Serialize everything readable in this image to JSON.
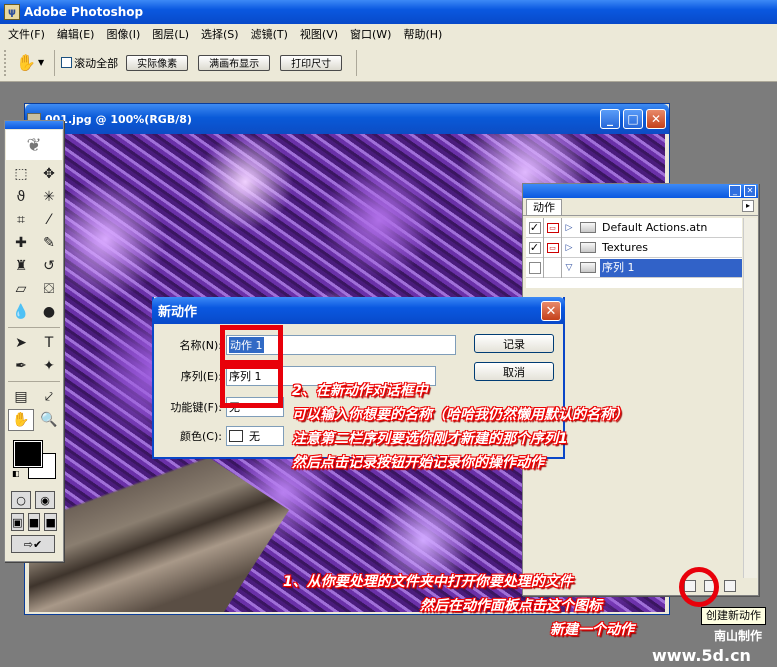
{
  "app": {
    "title": "Adobe Photoshop",
    "logo_icon": "photoshop-feather-icon"
  },
  "menu": [
    "文件(F)",
    "编辑(E)",
    "图像(I)",
    "图层(L)",
    "选择(S)",
    "滤镜(T)",
    "视图(V)",
    "窗口(W)",
    "帮助(H)"
  ],
  "options": {
    "tool_icon": "hand-icon",
    "scroll_all_label": "滚动全部",
    "buttons": [
      "实际像素",
      "满画布显示",
      "打印尺寸"
    ]
  },
  "document": {
    "title": "001.jpg @ 100%(RGB/8)"
  },
  "actions_panel": {
    "tab": "动作",
    "rows": [
      {
        "name": "Default Actions.atn",
        "checked": true,
        "dialog": true,
        "expanded": false,
        "selected": false
      },
      {
        "name": "Textures",
        "checked": true,
        "dialog": true,
        "expanded": false,
        "selected": false
      },
      {
        "name": "序列 1",
        "checked": false,
        "dialog": false,
        "expanded": true,
        "selected": true
      }
    ]
  },
  "dialog": {
    "title": "新动作",
    "name_label": "名称(N):",
    "name_value": "动作 1",
    "set_label": "序列(E):",
    "set_value": "序列 1",
    "fkey_label": "功能键(F):",
    "fkey_value": "无",
    "color_label": "颜色(C):",
    "color_value": "无",
    "record_button": "记录",
    "cancel_button": "取消"
  },
  "annotations": {
    "step2": [
      "2、在新动作对话框中",
      "可以输入你想要的名称（哈哈我仍然懒用默认的名称）",
      "注意第二栏序列要选你刚才新建的那个序列1",
      "然后点击记录按钮开始记录你的操作动作"
    ],
    "step1": [
      "1、从你要处理的文件夹中打开你要处理的文件",
      "然后在动作面板点击这个图标",
      "新建一个动作"
    ]
  },
  "tooltip": "创建新动作",
  "credit": "南山制作",
  "site": "www.5d.cn",
  "colors": {
    "annotation_red": "#e8000a",
    "titlebar_blue": "#0a58e0"
  }
}
